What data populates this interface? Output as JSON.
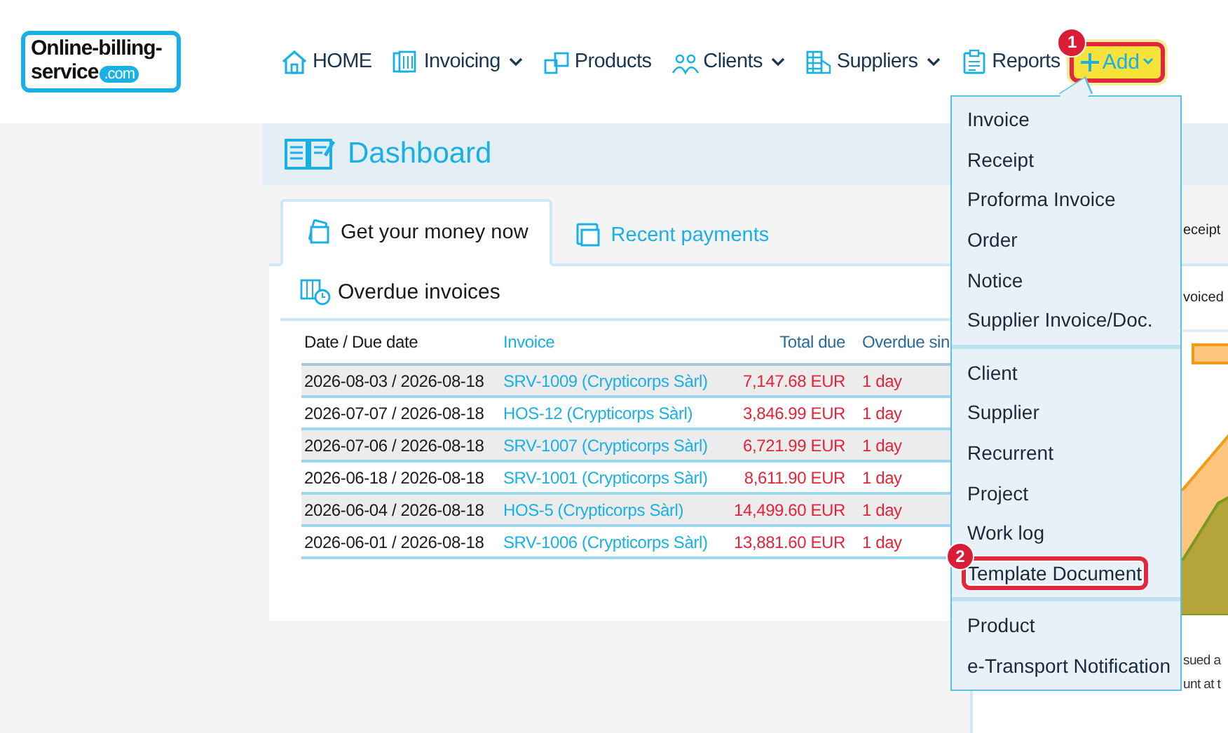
{
  "logo": {
    "line1": "Online-billing-",
    "line2": "service",
    "badge": ".com"
  },
  "nav": [
    {
      "label": "HOME",
      "dropdown": false
    },
    {
      "label": "Invoicing",
      "dropdown": true
    },
    {
      "label": "Products",
      "dropdown": false
    },
    {
      "label": "Clients",
      "dropdown": true
    },
    {
      "label": "Suppliers",
      "dropdown": true
    },
    {
      "label": "Reports",
      "dropdown": false
    }
  ],
  "add_button": {
    "label": "Add",
    "callout": "1",
    "highlighted": true
  },
  "page_title": "Dashboard",
  "tabs": [
    {
      "label": "Get your money now",
      "selected": true
    },
    {
      "label": "Recent payments",
      "selected": false
    }
  ],
  "section_title": "Overdue invoices",
  "table": {
    "columns": [
      "Date / Due date",
      "Invoice",
      "Total due",
      "Overdue sin"
    ],
    "rows": [
      {
        "dates": "2026-08-03 / 2026-08-18",
        "invoice": "SRV-1009 (Crypticorps Sàrl)",
        "total": "7,147.68 EUR",
        "overdue": "1 day"
      },
      {
        "dates": "2026-07-07 / 2026-08-18",
        "invoice": "HOS-12 (Crypticorps Sàrl)",
        "total": "3,846.99 EUR",
        "overdue": "1 day"
      },
      {
        "dates": "2026-07-06 / 2026-08-18",
        "invoice": "SRV-1007 (Crypticorps Sàrl)",
        "total": "6,721.99 EUR",
        "overdue": "1 day"
      },
      {
        "dates": "2026-06-18 / 2026-08-18",
        "invoice": "SRV-1001 (Crypticorps Sàrl)",
        "total": "8,611.90 EUR",
        "overdue": "1 day"
      },
      {
        "dates": "2026-06-04 / 2026-08-18",
        "invoice": "HOS-5 (Crypticorps Sàrl)",
        "total": "14,499.60 EUR",
        "overdue": "1 day"
      },
      {
        "dates": "2026-06-01 / 2026-08-18",
        "invoice": "SRV-1006 (Crypticorps Sàrl)",
        "total": "13,881.60 EUR",
        "overdue": "1 day"
      }
    ]
  },
  "side_panel": {
    "tab": "eceipt",
    "heading": "voiced",
    "note_lines": [
      "sued a",
      "unt at t"
    ]
  },
  "add_menu": {
    "groups": [
      [
        {
          "label": "Invoice",
          "highlighted": false
        },
        {
          "label": "Receipt",
          "highlighted": false
        },
        {
          "label": "Proforma Invoice",
          "highlighted": false
        },
        {
          "label": "Order",
          "highlighted": false
        },
        {
          "label": "Notice",
          "highlighted": false
        },
        {
          "label": "Supplier Invoice/Doc.",
          "highlighted": false
        }
      ],
      [
        {
          "label": "Client",
          "highlighted": false
        },
        {
          "label": "Supplier",
          "highlighted": false
        },
        {
          "label": "Recurrent",
          "highlighted": false
        },
        {
          "label": "Project",
          "highlighted": false
        },
        {
          "label": "Work log",
          "highlighted": false
        },
        {
          "label": "Template Document",
          "highlighted": true,
          "callout": "2"
        }
      ],
      [
        {
          "label": "Product",
          "highlighted": false
        },
        {
          "label": "e-Transport Notification",
          "highlighted": false
        }
      ]
    ]
  }
}
